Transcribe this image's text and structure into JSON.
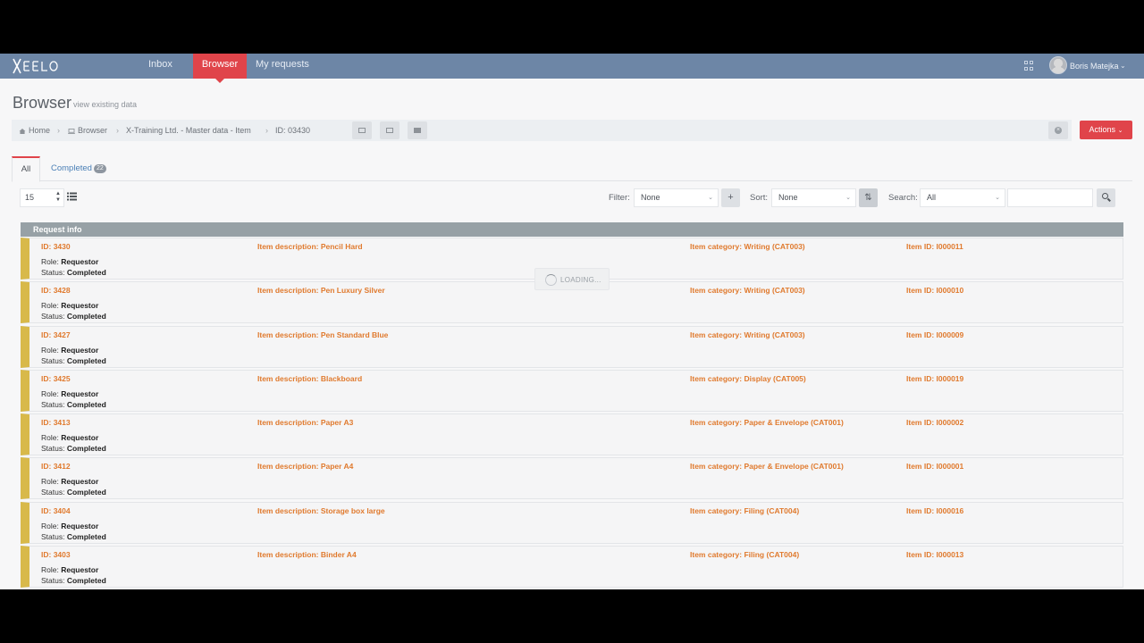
{
  "app": {
    "brand": "XEELO"
  },
  "nav": {
    "items": [
      {
        "label": "Inbox"
      },
      {
        "label": "Browser"
      },
      {
        "label": "My requests"
      }
    ],
    "active": "Browser",
    "user_name": "Boris Matejka",
    "accent_color": "#e0444a",
    "bar_color": "#6d86a6"
  },
  "header": {
    "title": "Browser",
    "subtitle": "view existing data"
  },
  "breadcrumb": {
    "items": [
      {
        "label": "Home",
        "icon": "home-icon"
      },
      {
        "label": "Browser",
        "icon": "monitor-icon"
      },
      {
        "label": "X-Training Ltd. - Master data - Item"
      },
      {
        "label": "ID: 03430"
      }
    ],
    "actions_label": "Actions"
  },
  "tabs": {
    "all_label": "All",
    "completed_label": "Completed",
    "completed_count": "22"
  },
  "toolbar": {
    "page_size": "15",
    "filter_label": "Filter:",
    "filter_value": "None",
    "sort_label": "Sort:",
    "sort_value": "None",
    "search_label": "Search:",
    "search_scope": "All",
    "search_value": ""
  },
  "list": {
    "header": "Request info",
    "loading_text": "LOADING...",
    "status_color": "#d8b94a",
    "rows": [
      {
        "id": "ID: 3430",
        "role_label": "Role:",
        "role": "Requestor",
        "status_label": "Status:",
        "status": "Completed",
        "description": "Item description: Pencil Hard",
        "category": "Item category: Writing (CAT003)",
        "item_id": "Item ID: I000011"
      },
      {
        "id": "ID: 3428",
        "role_label": "Role:",
        "role": "Requestor",
        "status_label": "Status:",
        "status": "Completed",
        "description": "Item description: Pen Luxury Silver",
        "category": "Item category: Writing (CAT003)",
        "item_id": "Item ID: I000010"
      },
      {
        "id": "ID: 3427",
        "role_label": "Role:",
        "role": "Requestor",
        "status_label": "Status:",
        "status": "Completed",
        "description": "Item description: Pen Standard Blue",
        "category": "Item category: Writing (CAT003)",
        "item_id": "Item ID: I000009"
      },
      {
        "id": "ID: 3425",
        "role_label": "Role:",
        "role": "Requestor",
        "status_label": "Status:",
        "status": "Completed",
        "description": "Item description: Blackboard",
        "category": "Item category: Display (CAT005)",
        "item_id": "Item ID: I000019"
      },
      {
        "id": "ID: 3413",
        "role_label": "Role:",
        "role": "Requestor",
        "status_label": "Status:",
        "status": "Completed",
        "description": "Item description: Paper A3",
        "category": "Item category: Paper & Envelope (CAT001)",
        "item_id": "Item ID: I000002"
      },
      {
        "id": "ID: 3412",
        "role_label": "Role:",
        "role": "Requestor",
        "status_label": "Status:",
        "status": "Completed",
        "description": "Item description: Paper A4",
        "category": "Item category: Paper & Envelope (CAT001)",
        "item_id": "Item ID: I000001"
      },
      {
        "id": "ID: 3404",
        "role_label": "Role:",
        "role": "Requestor",
        "status_label": "Status:",
        "status": "Completed",
        "description": "Item description: Storage box large",
        "category": "Item category: Filing (CAT004)",
        "item_id": "Item ID: I000016"
      },
      {
        "id": "ID: 3403",
        "role_label": "Role:",
        "role": "Requestor",
        "status_label": "Status:",
        "status": "Completed",
        "description": "Item description: Binder A4",
        "category": "Item category: Filing (CAT004)",
        "item_id": "Item ID: I000013"
      }
    ]
  }
}
